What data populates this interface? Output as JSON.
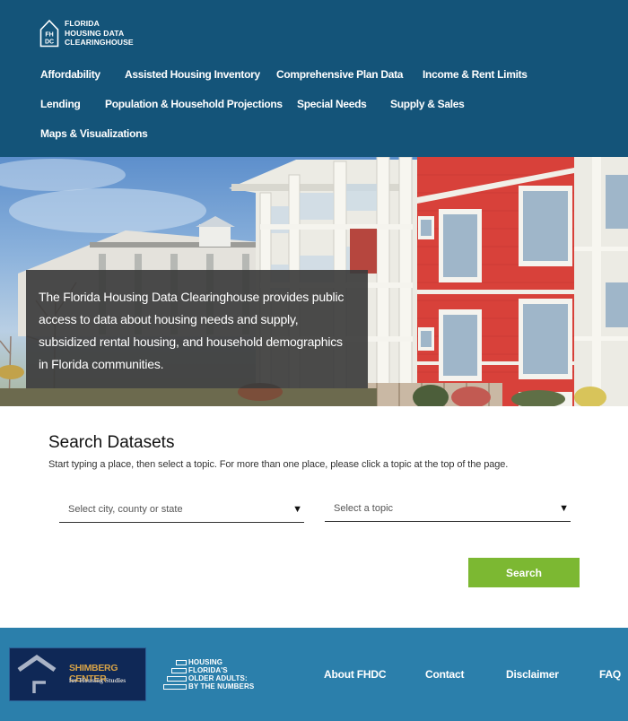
{
  "header": {
    "logo_mark": "FHDC",
    "logo_lines": [
      "FLORIDA",
      "HOUSING DATA",
      "CLEARINGHOUSE"
    ],
    "bg_color": "#145479"
  },
  "nav": {
    "rows": [
      [
        "Affordability",
        "Assisted Housing Inventory",
        "Comprehensive Plan Data",
        "Income & Rent Limits"
      ],
      [
        "Lending",
        "Population & Household Projections",
        "Special Needs",
        "Supply & Sales"
      ],
      [
        "Maps & Visualizations"
      ]
    ]
  },
  "hero": {
    "text": "The Florida Housing Data Clearinghouse provides public access to data about housing needs and supply, subsidized rental housing, and household demographics in Florida communities.",
    "image_description": "apartment-buildings-photo"
  },
  "search": {
    "title": "Search Datasets",
    "description": "Start typing a place, then select a topic. For more than one place, please click a topic at the top of the page.",
    "place_placeholder": "Select city, county or state",
    "topic_placeholder": "Select a topic",
    "dropdown_icon": "▼",
    "button_label": "Search",
    "button_color": "#7cb832"
  },
  "footer": {
    "bg_color": "#2b7fab",
    "shimberg_title": "SHIMBERG CENTER",
    "shimberg_subtitle": "for Housing Studies",
    "older_adults_lines": [
      "HOUSING",
      "FLORIDA'S",
      "OLDER ADULTS:",
      "BY THE NUMBERS"
    ],
    "links": [
      "About FHDC",
      "Contact",
      "Disclaimer",
      "FAQ"
    ]
  }
}
